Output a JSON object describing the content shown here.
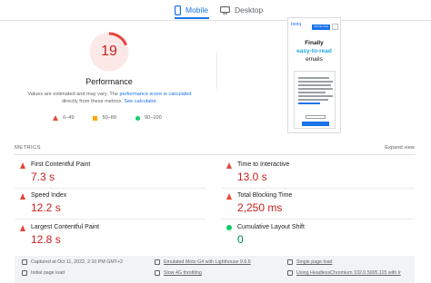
{
  "tabs": [
    {
      "label": "Mobile",
      "icon": "smartphone-icon",
      "active": true
    },
    {
      "label": "Desktop",
      "icon": "monitor-icon",
      "active": false
    }
  ],
  "score": {
    "value": "19",
    "title": "Performance",
    "note_prefix": "Values are estimated and may vary. The",
    "note_link1": "performance score is calculated",
    "note_middle": "directly from these metrics.",
    "note_link2": "See calculator.",
    "score_fraction": 0.19
  },
  "legend": [
    {
      "icon": "fail-triangle-icon",
      "range": "0–49"
    },
    {
      "icon": "average-square-icon",
      "range": "50–89"
    },
    {
      "icon": "pass-circle-icon",
      "range": "90–100"
    }
  ],
  "preview": {
    "brand": "bonq",
    "cta": "Join free bonq",
    "headline1": "Finally",
    "headline2": "easy-to-read",
    "headline3": "emails"
  },
  "metrics_section": {
    "label": "METRICS",
    "expand": "Expand view"
  },
  "metrics": [
    {
      "name": "First Contentful Paint",
      "value": "7.3 s",
      "status": "fail"
    },
    {
      "name": "Time to Interactive",
      "value": "13.0 s",
      "status": "fail"
    },
    {
      "name": "Speed Index",
      "value": "12.2 s",
      "status": "fail"
    },
    {
      "name": "Total Blocking Time",
      "value": "2,250 ms",
      "status": "fail"
    },
    {
      "name": "Largest Contentful Paint",
      "value": "12.8 s",
      "status": "fail"
    },
    {
      "name": "Cumulative Layout Shift",
      "value": "0",
      "status": "pass"
    }
  ],
  "footer": {
    "captured": "Captured at Oct 11, 2022, 2:10 PM GMT+2",
    "initial_load": "Initial page load",
    "emulated": "Emulated Moto G4 with Lighthouse 9.6.6",
    "throttling": "Slow 4G throttling",
    "single_load": "Single page load",
    "browser": "Using HeadlessChromium 102.0.5005.115 with lr"
  },
  "colors": {
    "accent": "#1a73e8",
    "fail": "#e8453c",
    "average": "#ffa400",
    "pass": "#0cce6b"
  }
}
